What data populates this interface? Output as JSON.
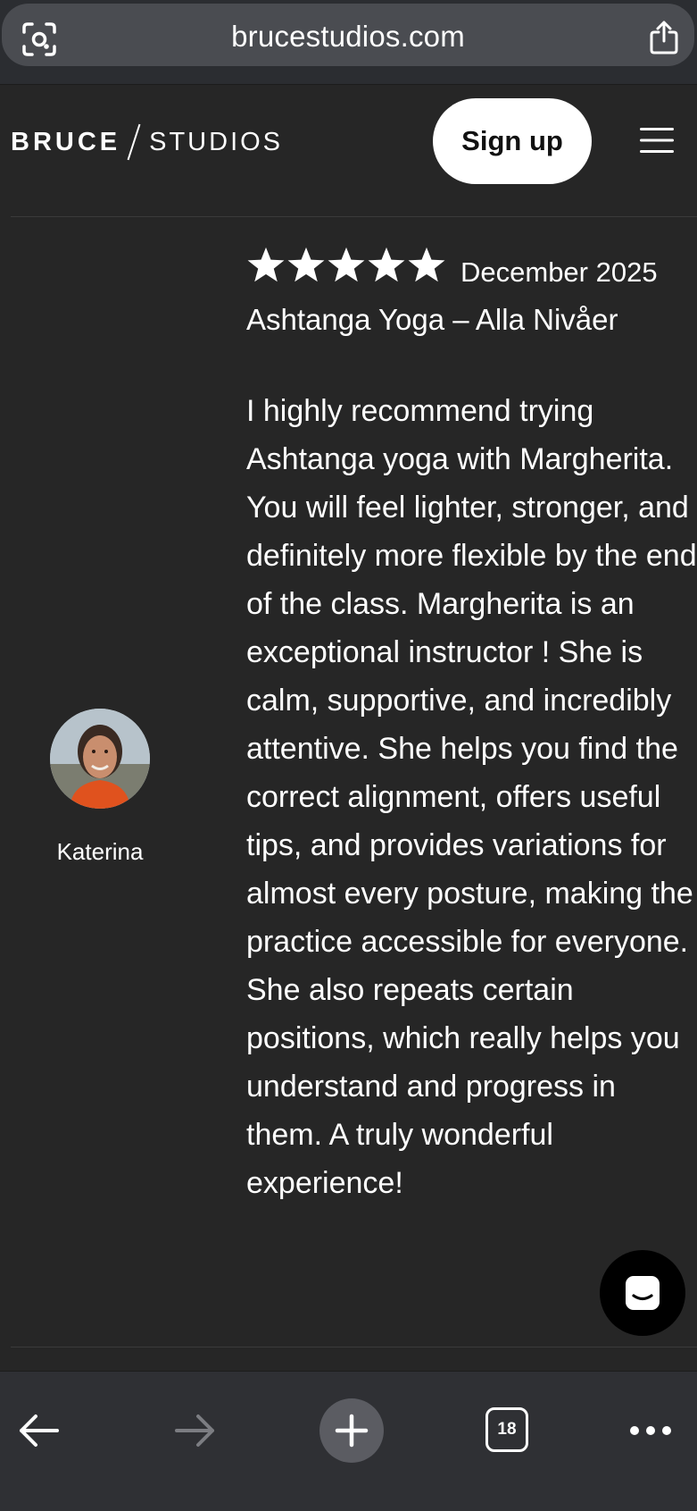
{
  "browser": {
    "url": "brucestudios.com",
    "lens_icon": "camera-lens-icon",
    "share_icon": "share-icon",
    "toolbar": {
      "back_icon": "arrow-left-icon",
      "forward_icon": "arrow-right-icon",
      "new_tab_icon": "plus-icon",
      "tab_count": "18",
      "more_icon": "more-dots-icon"
    }
  },
  "site": {
    "brand_primary": "BRUCE",
    "brand_secondary": "STUDIOS",
    "signup_label": "Sign up",
    "menu_icon": "hamburger-menu-icon"
  },
  "review": {
    "rating": 5,
    "max_rating": 5,
    "date": "December 2025",
    "class_title": "Ashtanga Yoga – Alla Nivåer",
    "body": "I highly recommend trying Ashtanga yoga with Margherita. You will feel lighter, stronger, and definitely more flexible by the end of the class. Margherita is an exceptional instructor ! She is calm, supportive, and incredibly attentive. She helps you find the correct alignment, offers useful tips, and provides variations for almost every posture, making the practice accessible for everyone. She also repeats certain positions, which really helps you understand and progress in them. A truly wonderful experience!",
    "author": "Katerina"
  },
  "chat": {
    "icon": "chat-bubble-icon"
  },
  "colors": {
    "background": "#262626",
    "browser_chrome": "#2b2d31",
    "signup_bg": "#ffffff",
    "text": "#ffffff"
  }
}
